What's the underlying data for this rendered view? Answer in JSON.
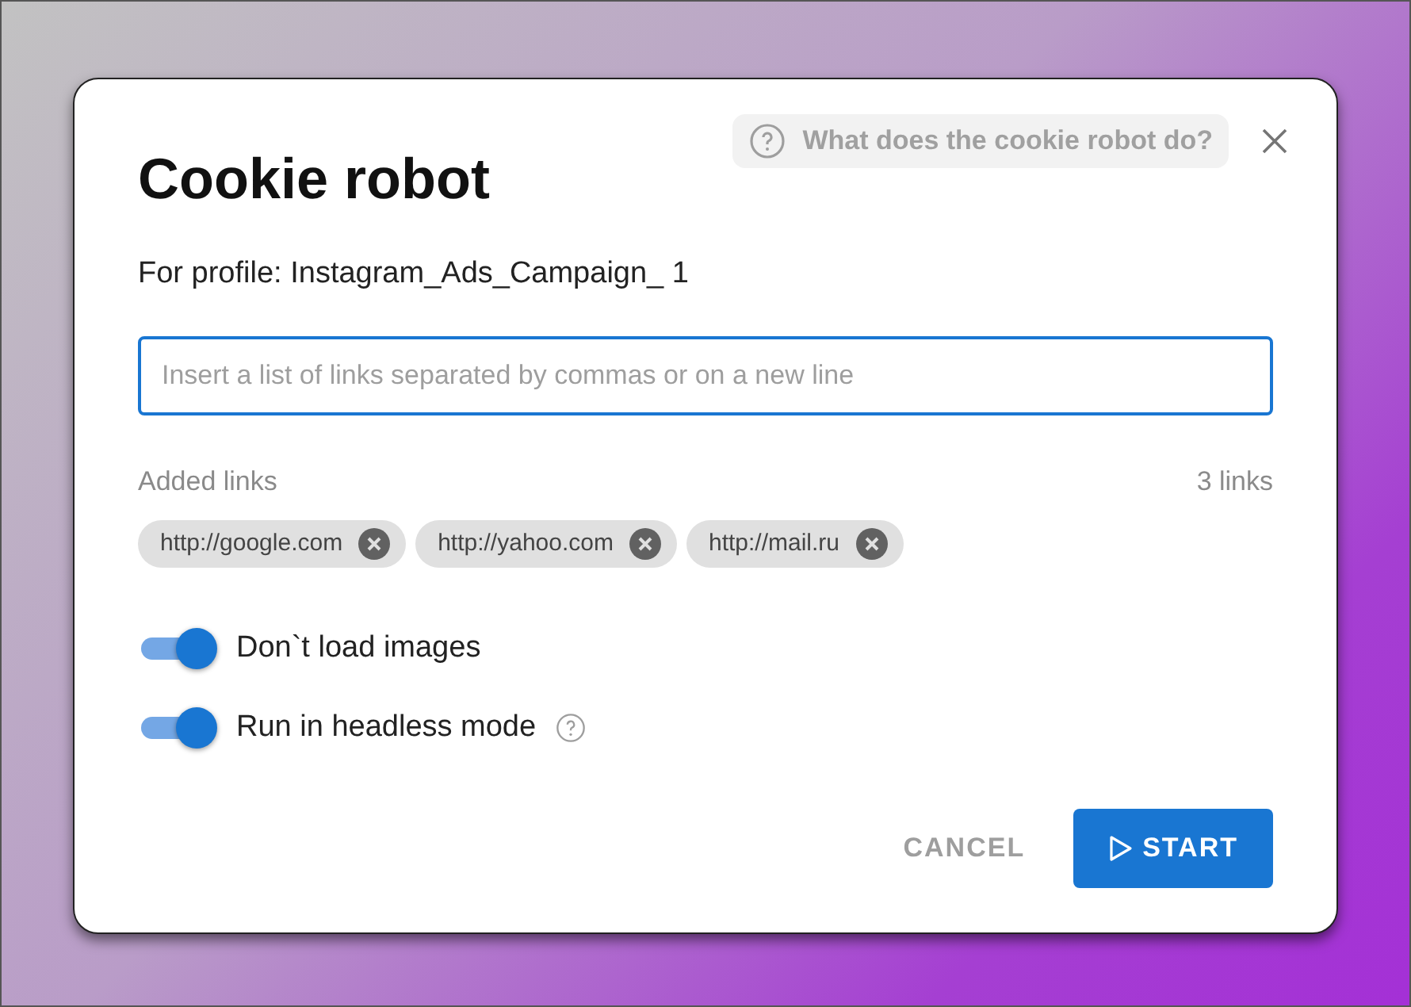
{
  "dialog": {
    "title": "Cookie robot",
    "help_link": "What does the cookie robot do?",
    "profile_label": "For profile:",
    "profile_name": "Instagram_Ads_Campaign_ 1"
  },
  "links_field": {
    "placeholder": "Insert a list of links separated by commas or on a new line"
  },
  "added_links": {
    "label": "Added links",
    "count": "3 links",
    "chips": [
      {
        "text": "http://google.com"
      },
      {
        "text": "http://yahoo.com"
      },
      {
        "text": "http://mail.ru"
      }
    ]
  },
  "options": [
    {
      "label": "Don`t load images",
      "on": true,
      "help": false
    },
    {
      "label": "Run in headless mode",
      "on": true,
      "help": true
    }
  ],
  "buttons": [
    {
      "label": "CANCEL",
      "kind": "text"
    },
    {
      "label": "START",
      "kind": "primary"
    }
  ]
}
